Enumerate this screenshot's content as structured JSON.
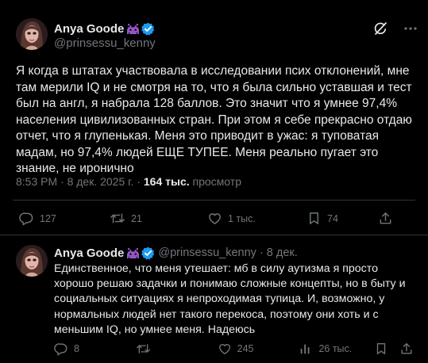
{
  "main_tweet": {
    "author": {
      "display_name": "Anya Goode",
      "handle": "@prinsessu_kenny"
    },
    "text": "Я когда в штатах участвовала в исследовании псих отклонений, мне там мерили IQ и не смотря на то, что я была сильно уставшая и тест был на англ, я набрала 128 баллов. Это значит что я умнее 97,4% населения цивилизованных стран. При этом я себе прекрасно отдаю отчет, что я глупенькая. Меня это приводит в ужас: я туповатая мадам, но 97,4% людей ЕЩЕ ТУПЕЕ. Меня реально пугает это знание, не иронично",
    "timestamp": "8:53 PM · 8 дек. 2025 г. · ",
    "views_count": "164 тыс.",
    "views_label": " просмотр",
    "actions": {
      "replies": "127",
      "reposts": "21",
      "likes": "1 тыс.",
      "bookmarks": "74"
    }
  },
  "reply_tweet": {
    "author": {
      "display_name": "Anya Goode",
      "handle": "@prinsessu_kenny · 8 дек."
    },
    "text": "Единственное, что меня утешает: мб в силу аутизма я просто хорошо решаю задачки и понимаю сложные концепты, но в быту и социальных ситуациях я непроходимая тупица. И, возможно, у нормальных людей нет такого перекоса, поэтому они хоть и с меньшим IQ, но умнее меня. Надеюсь",
    "actions": {
      "replies": "8",
      "reposts": "",
      "likes": "245",
      "views": "26 тыс."
    }
  },
  "colors": {
    "background": "#000000",
    "text": "#e7e9ea",
    "muted": "#71767b",
    "verified": "#1d9bf0",
    "emoji": "#9b59d0",
    "divider": "#2f3336"
  },
  "icons": [
    "grok-icon",
    "more-icon",
    "verified-badge-icon",
    "alien-monster-emoji",
    "reply-icon",
    "repost-icon",
    "like-icon",
    "bookmark-icon",
    "views-icon",
    "share-icon"
  ]
}
